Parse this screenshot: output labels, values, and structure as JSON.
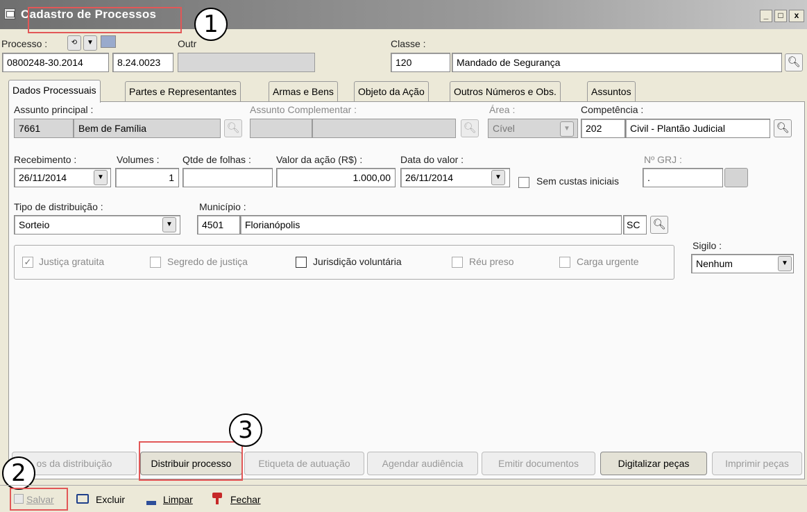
{
  "window": {
    "title": "Cadastro de Processos",
    "controls": [
      "_",
      "□",
      "x"
    ]
  },
  "annotations": [
    "1",
    "2",
    "3"
  ],
  "header": {
    "processo_label": "Processo :",
    "processo_numero": "0800248-30.2014",
    "processo_orgao": "8.24.0023",
    "outros_label": "Outr",
    "classe_label": "Classe :",
    "classe_codigo": "120",
    "classe_nome": "Mandado de Segurança"
  },
  "tabs": [
    {
      "label": "Dados Processuais"
    },
    {
      "label": "Partes e Representantes"
    },
    {
      "label": "Armas e Bens"
    },
    {
      "label": "Objeto da Ação"
    },
    {
      "label": "Outros Números e Obs."
    },
    {
      "label": "Assuntos"
    }
  ],
  "form": {
    "assunto_principal_label": "Assunto principal :",
    "assunto_principal_codigo": "7661",
    "assunto_principal_nome": "Bem de Família",
    "assunto_complementar_label": "Assunto Complementar :",
    "area_label": "Área :",
    "area_value": "Cível",
    "competencia_label": "Competência :",
    "competencia_codigo": "202",
    "competencia_nome": "Civil - Plantão Judicial",
    "recebimento_label": "Recebimento :",
    "recebimento_value": "26/11/2014",
    "volumes_label": "Volumes :",
    "volumes_value": "1",
    "folhas_label": "Qtde de folhas :",
    "folhas_value": "",
    "valor_label": "Valor da ação (R$) :",
    "valor_value": "1.000,00",
    "data_valor_label": "Data do valor :",
    "data_valor_value": "26/11/2014",
    "sem_custas_label": "Sem custas iniciais",
    "grj_label": "Nº GRJ :",
    "grj_value": ".",
    "tipo_distribuicao_label": "Tipo de distribuição :",
    "tipo_distribuicao_value": "Sorteio",
    "municipio_label": "Município :",
    "municipio_codigo": "4501",
    "municipio_nome": "Florianópolis",
    "municipio_uf": "SC",
    "sigilo_label": "Sigilo :",
    "sigilo_value": "Nenhum"
  },
  "checkboxes": [
    {
      "label": "Justiça gratuita",
      "checked": true
    },
    {
      "label": "Segredo de justiça",
      "checked": false
    },
    {
      "label": "Jurisdição voluntária",
      "checked": false
    },
    {
      "label": "Réu preso",
      "checked": false
    },
    {
      "label": "Carga urgente",
      "checked": false
    }
  ],
  "bottom_buttons": [
    {
      "label": "os da distribuição"
    },
    {
      "label": "Distribuir processo"
    },
    {
      "label": "Etiqueta de autuação"
    },
    {
      "label": "Agendar audiência"
    },
    {
      "label": "Emitir documentos"
    },
    {
      "label": "Digitalizar peças"
    },
    {
      "label": "Imprimir peças"
    }
  ],
  "toolbar": {
    "salvar": "Salvar",
    "excluir": "Excluir",
    "limpar": "Limpar",
    "fechar": "Fechar"
  },
  "icons": {
    "search": "magnifier-icon",
    "dropdown": "chevron-down-icon"
  }
}
